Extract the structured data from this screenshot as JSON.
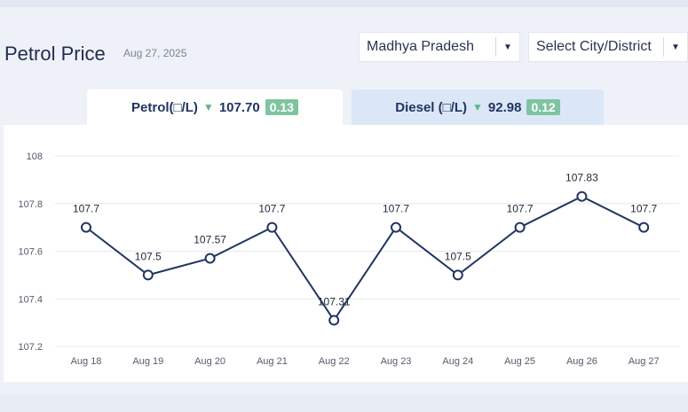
{
  "header": {
    "title": "Petrol Price",
    "date": "Aug 27, 2025",
    "state_select": {
      "value": "Madhya Pradesh"
    },
    "city_select": {
      "value": "Select City/District"
    }
  },
  "tabs": [
    {
      "label": "Petrol(□/L)",
      "price": "107.70",
      "change": "0.13",
      "direction": "down",
      "active": true
    },
    {
      "label": "Diesel (□/L)",
      "price": "92.98",
      "change": "0.12",
      "direction": "down",
      "active": false
    }
  ],
  "icons": {
    "select_arrow": "caret-down-icon",
    "price_trend": "triangle-down-icon"
  },
  "colors": {
    "accent": "#1f3461",
    "line": "#1f3461",
    "change_badge": "#7fc4a0",
    "down_arrow": "#5cb889",
    "inactive_tab": "#dbe6f6"
  },
  "chart_data": {
    "type": "line",
    "categories": [
      "Aug 18",
      "Aug 19",
      "Aug 20",
      "Aug 21",
      "Aug 22",
      "Aug 23",
      "Aug 24",
      "Aug 25",
      "Aug 26",
      "Aug 27"
    ],
    "series": [
      {
        "values": [
          107.7,
          107.5,
          107.57,
          107.7,
          107.31,
          107.7,
          107.5,
          107.7,
          107.83,
          107.7
        ],
        "labels": [
          "107.7",
          "107.5",
          "107.57",
          "107.7",
          "107.31",
          "107.7",
          "107.5",
          "107.7",
          "107.83",
          "107.7"
        ]
      }
    ],
    "ylim": [
      107.2,
      108
    ],
    "yticks": [
      107.2,
      107.4,
      107.6,
      107.8,
      108
    ],
    "ytick_labels": [
      "107.2",
      "107.4",
      "107.6",
      "107.8",
      "108"
    ],
    "grid": true,
    "title": "",
    "xlabel": "",
    "ylabel": ""
  }
}
